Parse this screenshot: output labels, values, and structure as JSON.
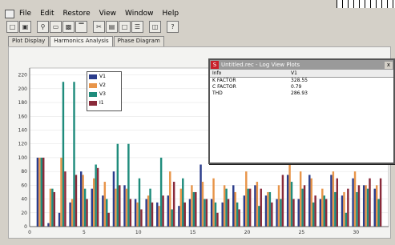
{
  "menu": {
    "items": [
      "File",
      "Edit",
      "Restore",
      "View",
      "Window",
      "Help"
    ]
  },
  "toolbar": {
    "buttons": [
      "open-icon",
      "save-icon",
      "zoom-icon",
      "frame-icon",
      "copy-icon",
      "chart-icon",
      "cut-icon",
      "print-icon",
      "paste-icon",
      "export-icon",
      "window-icon",
      "help-icon"
    ],
    "help_label": "?"
  },
  "tabs": [
    "Plot Display",
    "Harmonics Analysis",
    "Phase Diagram"
  ],
  "active_tab": 1,
  "log_window": {
    "app_icon": "S",
    "title": "Untitled.rec - Log View Plots",
    "close_label": "x",
    "columns": [
      "Info",
      "V1"
    ],
    "rows": [
      {
        "label": "K FACTOR",
        "value": "328.55"
      },
      {
        "label": "C FACTOR",
        "value": "0.79"
      },
      {
        "label": "THD",
        "value": "286.93"
      }
    ]
  },
  "legend": [
    "V1",
    "V2",
    "V3",
    "I1"
  ],
  "colors": {
    "V1": "#2b3d8c",
    "V2": "#e8954a",
    "V3": "#1f8c7c",
    "I1": "#8a2a3a"
  },
  "chart_data": {
    "type": "bar",
    "ylim": [
      0,
      230
    ],
    "yticks": [
      0,
      20,
      40,
      60,
      80,
      100,
      120,
      140,
      160,
      180,
      200,
      220
    ],
    "xlim": [
      0,
      33
    ],
    "xticks": [
      0,
      5,
      10,
      15,
      20,
      25,
      30
    ],
    "categories": [
      1,
      2,
      3,
      4,
      5,
      6,
      7,
      8,
      9,
      10,
      11,
      12,
      13,
      14,
      15,
      16,
      17,
      18,
      19,
      20,
      21,
      22,
      23,
      24,
      25,
      26,
      27,
      28,
      29,
      30,
      31,
      32
    ],
    "series": [
      {
        "name": "V1",
        "values": [
          100,
          5,
          20,
          35,
          80,
          55,
          45,
          80,
          60,
          40,
          40,
          35,
          45,
          30,
          40,
          90,
          40,
          35,
          60,
          45,
          60,
          45,
          40,
          75,
          40,
          75,
          40,
          75,
          45,
          70,
          60,
          55
        ]
      },
      {
        "name": "V2",
        "values": [
          100,
          55,
          100,
          40,
          75,
          70,
          65,
          55,
          55,
          35,
          45,
          30,
          80,
          55,
          60,
          65,
          70,
          60,
          50,
          80,
          65,
          50,
          60,
          90,
          80,
          70,
          55,
          80,
          50,
          80,
          60,
          60
        ]
      },
      {
        "name": "V3",
        "values": [
          100,
          55,
          210,
          210,
          55,
          90,
          40,
          120,
          120,
          70,
          55,
          100,
          25,
          70,
          50,
          40,
          35,
          55,
          35,
          55,
          30,
          50,
          40,
          65,
          55,
          35,
          45,
          50,
          20,
          50,
          55,
          40
        ]
      },
      {
        "name": "I1",
        "values": [
          100,
          50,
          80,
          75,
          40,
          85,
          20,
          60,
          40,
          25,
          35,
          45,
          65,
          35,
          50,
          40,
          20,
          40,
          25,
          55,
          55,
          35,
          75,
          40,
          60,
          45,
          40,
          70,
          55,
          60,
          70,
          70
        ]
      }
    ]
  }
}
